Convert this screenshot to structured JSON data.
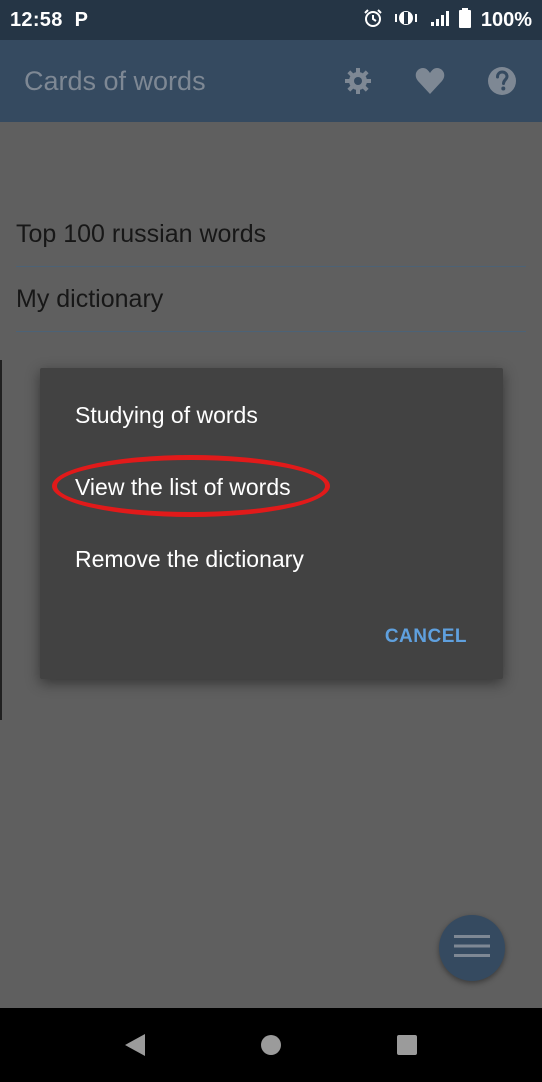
{
  "status_bar": {
    "time": "12:58",
    "p_label": "P",
    "battery_percent": "100%",
    "icons": [
      "alarm-icon",
      "vibrate-icon",
      "signal-icon",
      "battery-icon"
    ]
  },
  "app_bar": {
    "title": "Cards of words",
    "actions": [
      "gear-icon",
      "heart-icon",
      "help-icon"
    ]
  },
  "dictionaries": [
    {
      "label": "Top 100 russian words"
    },
    {
      "label": "My dictionary"
    }
  ],
  "dialog": {
    "options": [
      {
        "label": "Studying of words"
      },
      {
        "label": "View the list of words"
      },
      {
        "label": "Remove the dictionary"
      }
    ],
    "cancel_label": "CANCEL"
  },
  "fab": {
    "icon": "menu-icon"
  },
  "nav_bar": {
    "buttons": [
      "back-icon",
      "home-icon",
      "recents-icon"
    ]
  },
  "colors": {
    "status_bar": "#253545",
    "app_bar": "#354a60",
    "dialog_bg": "#424242",
    "cancel_accent": "#5fa0de",
    "highlight": "#e11a1a"
  }
}
